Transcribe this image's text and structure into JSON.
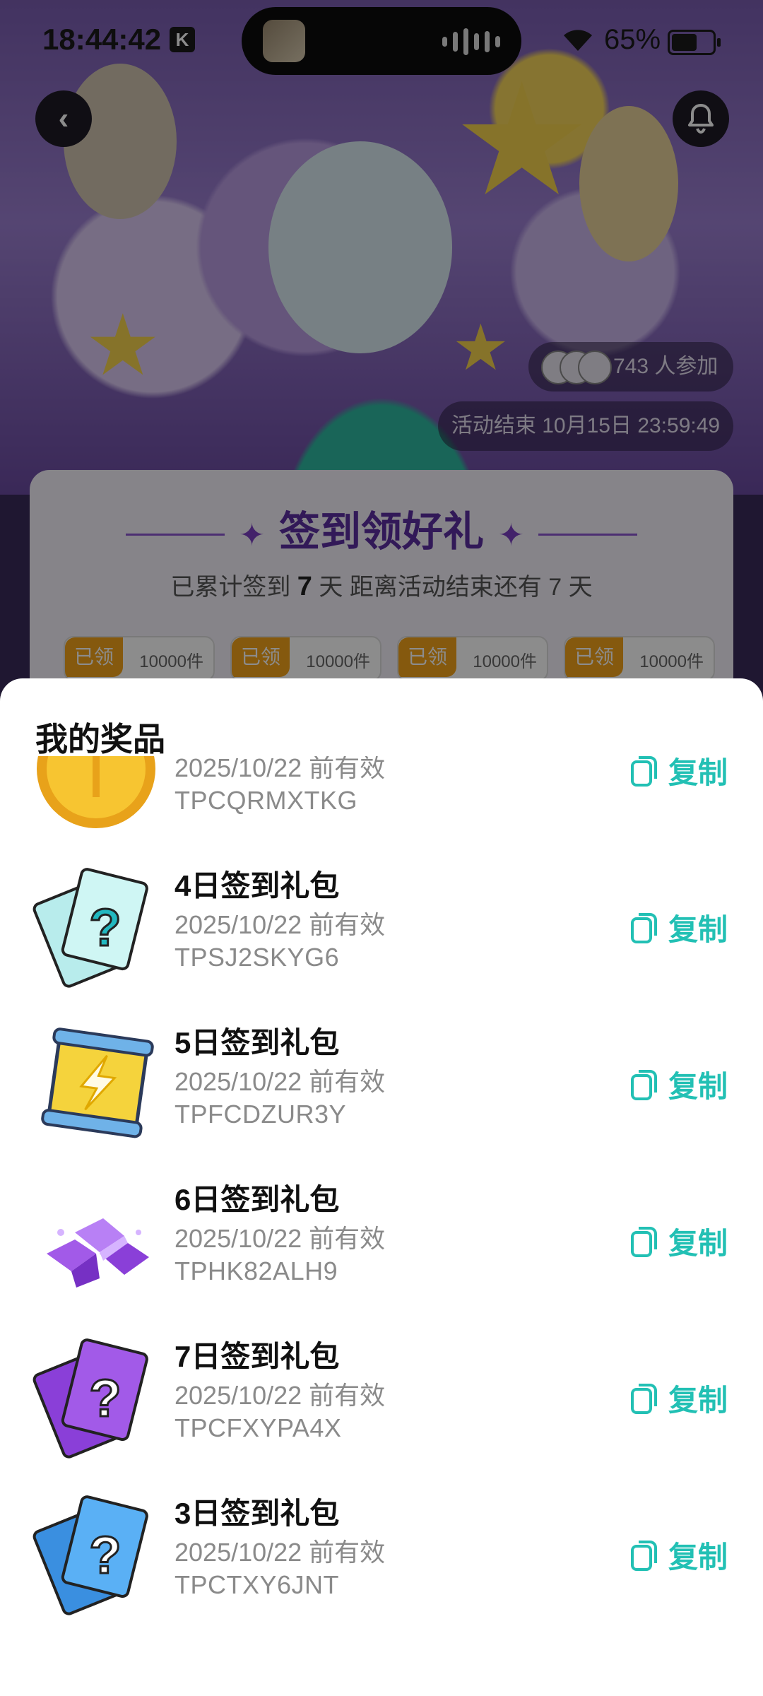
{
  "status_bar": {
    "time": "18:44:42",
    "battery": "65%",
    "battery_level": 0.65
  },
  "activity": {
    "participants": "743 人参加",
    "end_time": "活动结束 10月15日 23:59:49",
    "sign_title": "签到领好礼",
    "sign_progress_prefix": "已累计签到",
    "sign_days": "7",
    "sign_progress_mid": "天  距离活动结束还有",
    "remaining_days": "7",
    "sign_progress_suffix": "天",
    "day_chips": [
      {
        "status": "已领",
        "count": "10000件"
      },
      {
        "status": "已领",
        "count": "10000件"
      },
      {
        "status": "已领",
        "count": "10000件"
      },
      {
        "status": "已领",
        "count": "10000件"
      }
    ]
  },
  "sheet": {
    "title": "我的奖品",
    "copy_label": "复制",
    "prizes": [
      {
        "name": "",
        "valid": "2025/10/22 前有效",
        "code": "TPCQRMXTKG",
        "icon": "gold-coin-icon"
      },
      {
        "name": "4日签到礼包",
        "valid": "2025/10/22 前有效",
        "code": "TPSJ2SKYG6",
        "icon": "mystery-card-cyan-icon"
      },
      {
        "name": "5日签到礼包",
        "valid": "2025/10/22 前有效",
        "code": "TPFCDZUR3Y",
        "icon": "lightning-scroll-icon"
      },
      {
        "name": "6日签到礼包",
        "valid": "2025/10/22 前有效",
        "code": "TPHK82ALH9",
        "icon": "purple-crystals-icon"
      },
      {
        "name": "7日签到礼包",
        "valid": "2025/10/22 前有效",
        "code": "TPCFXYPA4X",
        "icon": "mystery-card-purple-icon"
      },
      {
        "name": "3日签到礼包",
        "valid": "2025/10/22 前有效",
        "code": "TPCTXY6JNT",
        "icon": "mystery-card-blue-icon"
      }
    ]
  },
  "colors": {
    "accent": "#22c0b4",
    "badge": "#f2a21a"
  }
}
